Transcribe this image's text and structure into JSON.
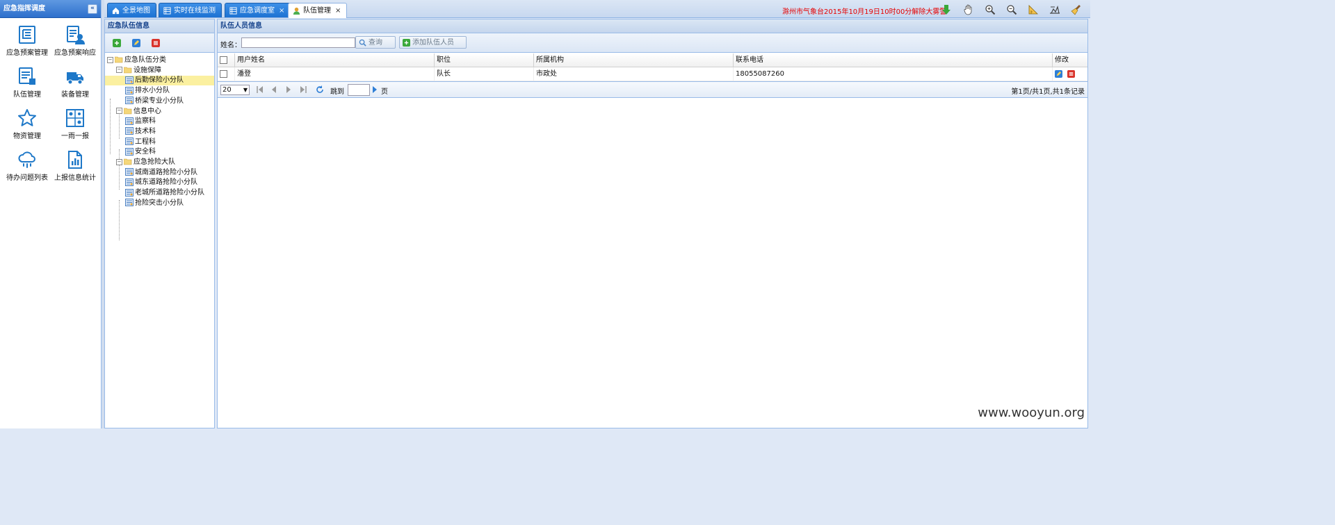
{
  "left_panel": {
    "title": "应急指挥调度",
    "collapse_icon": "double-chevron-left-icon",
    "items": [
      {
        "label": "应急预案管理",
        "icon": "plan-management-icon"
      },
      {
        "label": "应急预案响应",
        "icon": "plan-response-icon"
      },
      {
        "label": "队伍管理",
        "icon": "team-management-icon"
      },
      {
        "label": "装备管理",
        "icon": "equipment-truck-icon"
      },
      {
        "label": "物资管理",
        "icon": "materials-star-icon"
      },
      {
        "label": "一雨一报",
        "icon": "rain-report-map-icon"
      },
      {
        "label": "待办问题列表",
        "icon": "rain-cloud-icon"
      },
      {
        "label": "上报信息统计",
        "icon": "report-statistics-icon"
      }
    ]
  },
  "tabs": [
    {
      "label": "全景地图",
      "icon": "home-icon",
      "closable": false
    },
    {
      "label": "实时在线监测",
      "icon": "grid-icon",
      "closable": false
    },
    {
      "label": "应急调度室",
      "icon": "grid-icon",
      "closable": true
    },
    {
      "label": "队伍管理",
      "icon": "user-icon",
      "closable": true,
      "active": true
    }
  ],
  "tab_close_glyph": "×",
  "weather_notice": "滁州市气象台2015年10月19日10时00分解除大雾警",
  "toolbar_icons": [
    "download-arrow-icon",
    "pan-hand-icon",
    "zoom-in-icon",
    "zoom-out-icon",
    "measure-ruler-icon",
    "measure-area-icon",
    "clear-broom-icon"
  ],
  "tree_panel": {
    "title": "应急队伍信息",
    "toolbar": [
      "add-icon",
      "edit-icon",
      "delete-icon"
    ],
    "nodes": [
      {
        "label": "应急队伍分类",
        "level": 0,
        "type": "root"
      },
      {
        "label": "设施保障",
        "level": 1,
        "type": "folder"
      },
      {
        "label": "后勤保险小分队",
        "level": 2,
        "type": "leaf",
        "selected": true
      },
      {
        "label": "排水小分队",
        "level": 2,
        "type": "leaf"
      },
      {
        "label": "桥梁专业小分队",
        "level": 2,
        "type": "leaf"
      },
      {
        "label": "信息中心",
        "level": 1,
        "type": "folder"
      },
      {
        "label": "监察科",
        "level": 2,
        "type": "leaf"
      },
      {
        "label": "技术科",
        "level": 2,
        "type": "leaf"
      },
      {
        "label": "工程科",
        "level": 2,
        "type": "leaf"
      },
      {
        "label": "安全科",
        "level": 2,
        "type": "leaf"
      },
      {
        "label": "应急抢险大队",
        "level": 1,
        "type": "folder"
      },
      {
        "label": "城南道路抢险小分队",
        "level": 2,
        "type": "leaf"
      },
      {
        "label": "城东道路抢险小分队",
        "level": 2,
        "type": "leaf"
      },
      {
        "label": "老城所道路抢险小分队",
        "level": 2,
        "type": "leaf"
      },
      {
        "label": "抢险突击小分队",
        "level": 2,
        "type": "leaf"
      }
    ]
  },
  "member_panel": {
    "title": "队伍人员信息",
    "search_label": "姓名：",
    "search_value": "",
    "search_button": "查询",
    "add_button": "添加队伍人员",
    "columns": [
      "用户姓名",
      "职位",
      "所属机构",
      "联系电话",
      "修改"
    ],
    "rows": [
      {
        "name": "潘登",
        "position": "队长",
        "org": "市政处",
        "phone": "18055087260"
      }
    ],
    "pager": {
      "page_size": "20",
      "goto_label": "跳到",
      "page_unit": "页",
      "goto_value": "",
      "summary": "第1页/共1页,共1条记录"
    }
  },
  "watermark": "www.wooyun.org"
}
